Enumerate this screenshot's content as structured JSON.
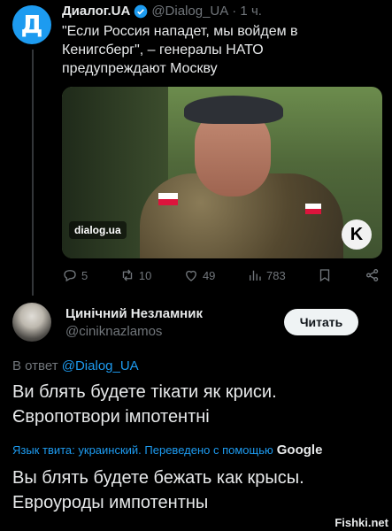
{
  "tweet1": {
    "display_name": "Диалог.UA",
    "handle": "@Dialog_UA",
    "time": "· 1 ч.",
    "text": "\"Если Россия нападет, мы войдем в Кенигсберг\", – генералы НАТО предупреждают Москву",
    "image_watermark": "dialog.ua",
    "stats": {
      "replies": "5",
      "retweets": "10",
      "likes": "49",
      "views": "783"
    }
  },
  "tweet2": {
    "display_name": "Цинічний Незламник",
    "handle": "@ciniknazlamos",
    "follow_label": "Читать",
    "reply_prefix": "В ответ",
    "reply_to": "@Dialog_UA",
    "text": "Ви блять будете тікати як криси. Європотвори імпотентні",
    "translate_note": "Язык твита: украинский. Переведено с помощью",
    "translate_provider": "Google",
    "translated_text": "Вы блять будете бежать как крысы. Евроуроды импотентны"
  },
  "watermark": "Fishki.net",
  "colors": {
    "accent": "#1d9bf0",
    "background": "#000000",
    "muted": "#71767b"
  }
}
